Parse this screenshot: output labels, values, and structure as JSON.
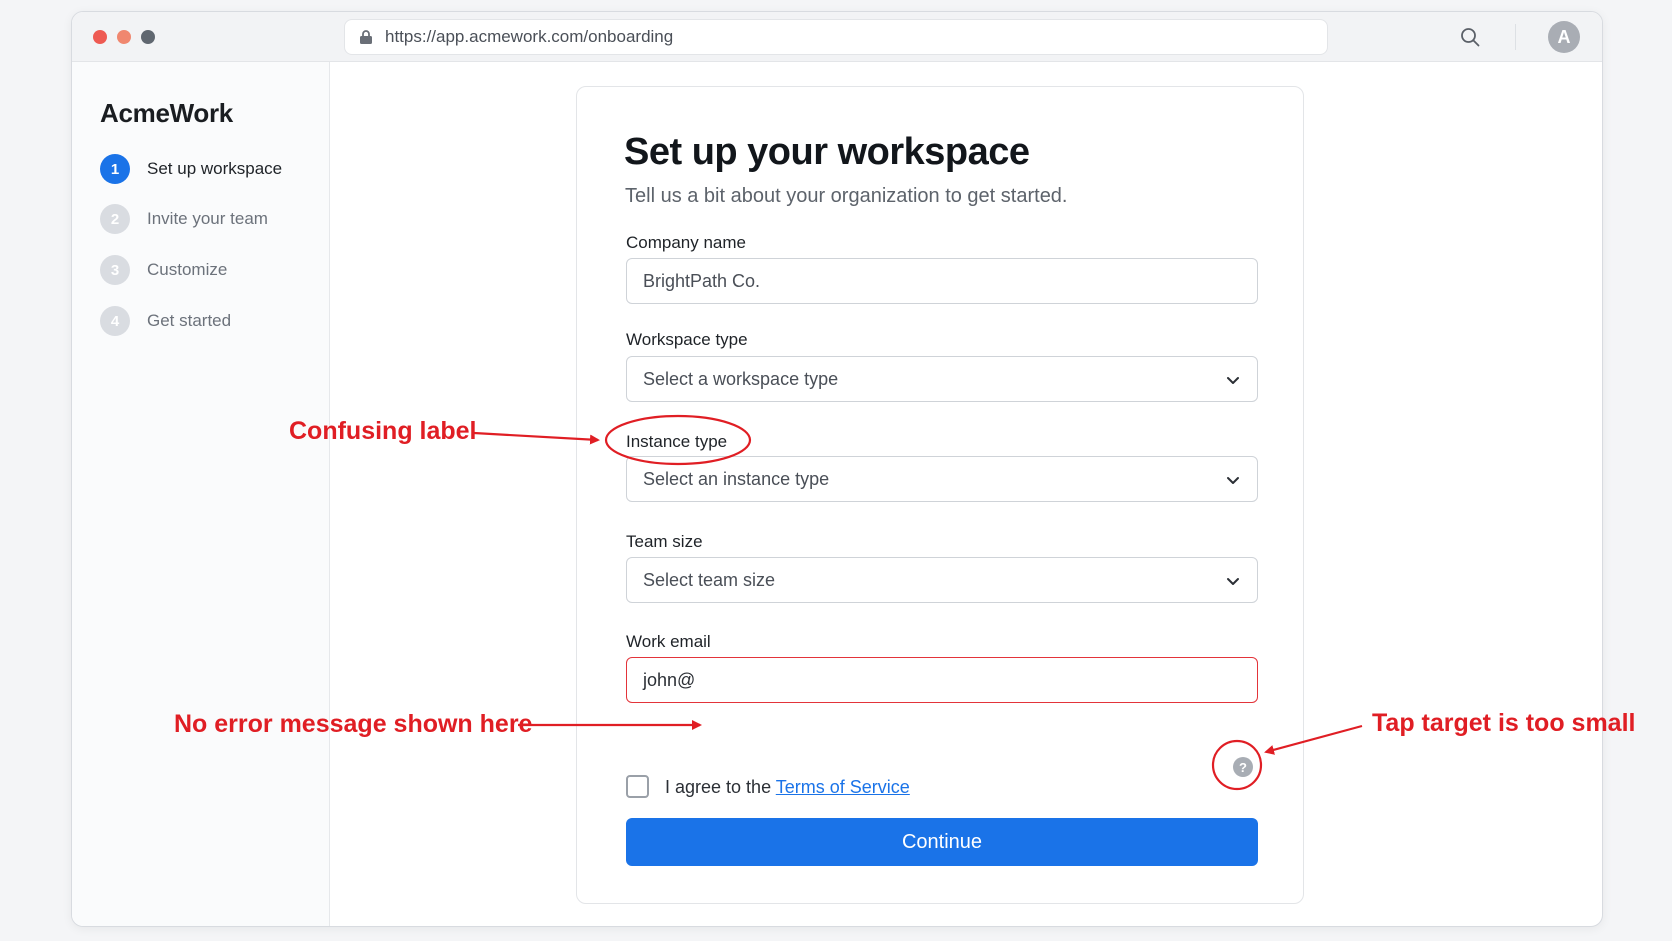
{
  "browser": {
    "url": "https://app.acmework.com/onboarding",
    "avatar_initial": "A"
  },
  "sidebar": {
    "brand": "AcmeWork",
    "steps": [
      {
        "num": "1",
        "label": "Set up workspace",
        "active": true
      },
      {
        "num": "2",
        "label": "Invite your team",
        "active": false
      },
      {
        "num": "3",
        "label": "Customize",
        "active": false
      },
      {
        "num": "4",
        "label": "Get started",
        "active": false
      }
    ]
  },
  "form": {
    "title": "Set up your workspace",
    "subtitle": "Tell us a bit about your organization to get started.",
    "company_label": "Company name",
    "company_value": "BrightPath Co.",
    "workspace_label": "Workspace type",
    "workspace_placeholder": "Select a workspace type",
    "instance_label": "Instance type",
    "instance_placeholder": "Select an instance type",
    "team_label": "Team size",
    "team_placeholder": "Select team size",
    "email_label": "Work email",
    "email_value": "john@",
    "agree_text": "I agree to the",
    "terms_link": "Terms of Service",
    "help_glyph": "?",
    "continue_label": "Continue"
  },
  "annotations": {
    "confusing_label": "Confusing label",
    "no_error": "No error message shown here",
    "tap_target": "Tap target is too small",
    "color": "#e01e24"
  },
  "colors": {
    "accent": "#1a73e8",
    "error_border": "#e3343a"
  }
}
